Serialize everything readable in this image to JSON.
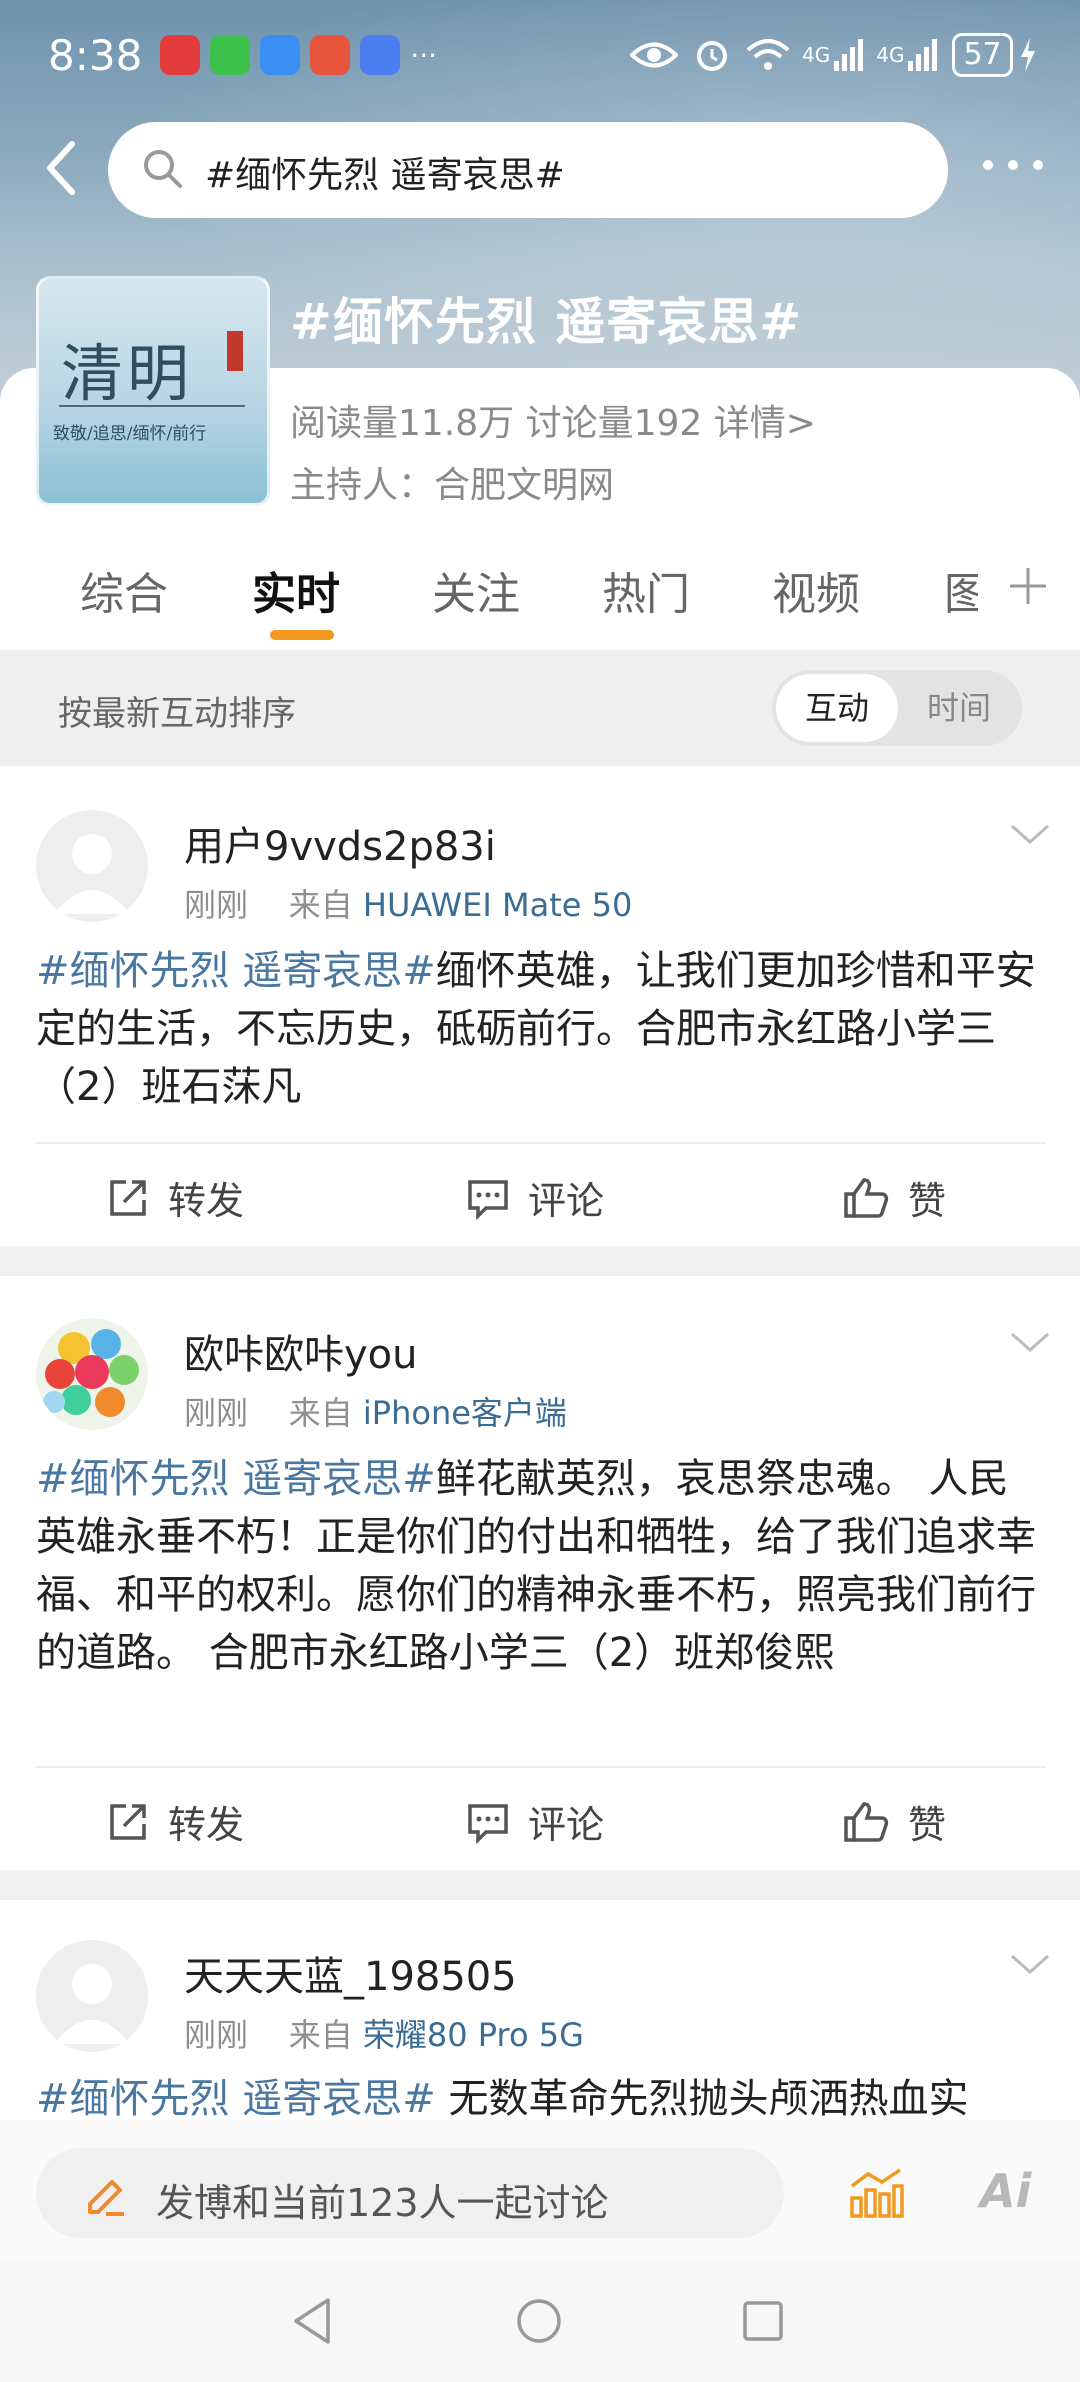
{
  "status_bar": {
    "time": "8:38",
    "battery": "57",
    "network_labels": [
      "4G",
      "4G"
    ],
    "more": "···"
  },
  "search": {
    "query": "#缅怀先烈 遥寄哀思#"
  },
  "topic": {
    "image_title": "清明",
    "image_subtitle": "致敬/追思/缅怀/前行",
    "title": "#缅怀先烈 遥寄哀思#",
    "stats": "阅读量11.8万  讨论量192  详情>",
    "host": "主持人：合肥文明网"
  },
  "tabs": [
    {
      "label": "综合"
    },
    {
      "label": "实时"
    },
    {
      "label": "关注"
    },
    {
      "label": "热门"
    },
    {
      "label": "视频"
    },
    {
      "label": "图"
    }
  ],
  "sort": {
    "label": "按最新互动排序",
    "option_active": "互动",
    "option_inactive": "时间"
  },
  "posts": [
    {
      "username": "用户9vvds2p83i",
      "time": "刚刚",
      "from_prefix": "来自",
      "source": "HUAWEI Mate 50",
      "tag": "#缅怀先烈 遥寄哀思#",
      "text": "缅怀英雄，让我们更加珍惜和平安定的生活，不忘历史，砥砺前行。合肥市永红路小学三（2）班石莯凡"
    },
    {
      "username": "欧咔欧咔you",
      "time": "刚刚",
      "from_prefix": "来自",
      "source": "iPhone客户端",
      "tag": "#缅怀先烈 遥寄哀思#",
      "text": "鲜花献英烈，哀思祭忠魂。 人民英雄永垂不朽！正是你们的付出和牺牲，给了我们追求幸福、和平的权利。愿你们的精神永垂不朽，照亮我们前行的道路。 合肥市永红路小学三（2）班郑俊熙"
    },
    {
      "username": "天天天蓝_198505",
      "time": "刚刚",
      "from_prefix": "来自",
      "source": "荣耀80 Pro 5G",
      "tag": "#缅怀先烈 遥寄哀思#",
      "text": " 无数革命先烈抛头颅洒热血实"
    }
  ],
  "actions": {
    "repost": "转发",
    "comment": "评论",
    "like": "赞"
  },
  "compose": {
    "placeholder": "发博和当前123人一起讨论",
    "ai_label": "Ai"
  },
  "colors": {
    "accent_orange": "#f29a1f",
    "link_blue": "#4a77a0"
  }
}
